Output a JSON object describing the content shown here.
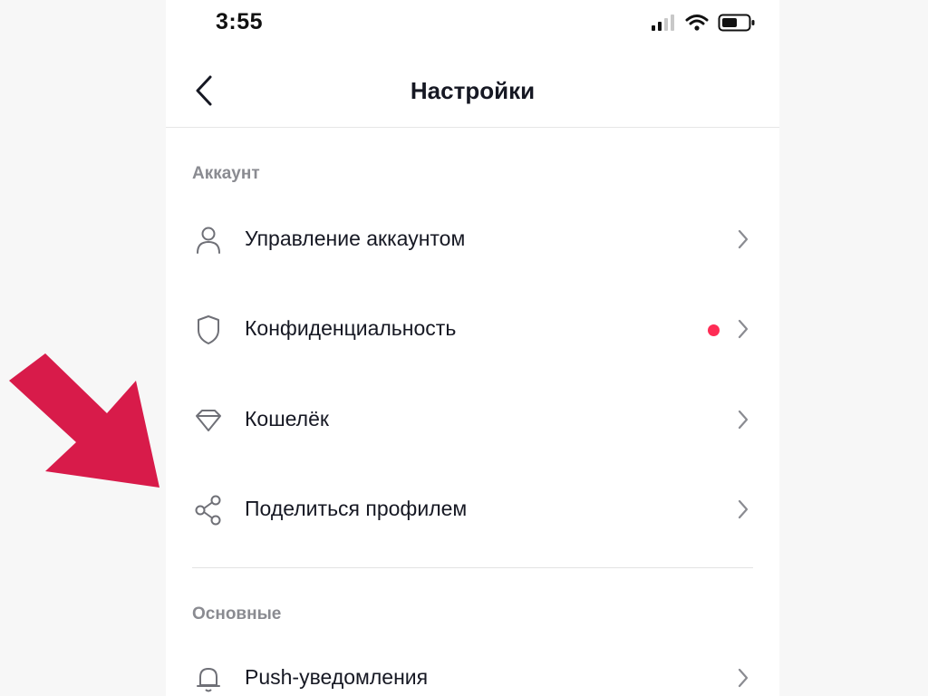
{
  "status_bar": {
    "time": "3:55",
    "icons": [
      "cellular-signal-icon",
      "wifi-icon",
      "battery-icon"
    ]
  },
  "nav": {
    "back_icon": "chevron-left-icon",
    "title": "Настройки"
  },
  "sections": [
    {
      "header": "Аккаунт",
      "items": [
        {
          "label": "Управление аккаунтом",
          "icon": "person-icon",
          "has_badge": false
        },
        {
          "label": "Конфиденциальность",
          "icon": "shield-icon",
          "has_badge": true
        },
        {
          "label": "Кошелёк",
          "icon": "diamond-icon",
          "has_badge": false
        },
        {
          "label": "Поделиться профилем",
          "icon": "share-icon",
          "has_badge": false
        }
      ]
    },
    {
      "header": "Основные",
      "items": [
        {
          "label": "Push-уведомления",
          "icon": "bell-icon",
          "has_badge": false
        }
      ]
    }
  ],
  "colors": {
    "annotation_arrow": "#d81b4a",
    "badge": "#fe2c55",
    "section_header": "#8a8b91",
    "text_primary": "#161823"
  }
}
